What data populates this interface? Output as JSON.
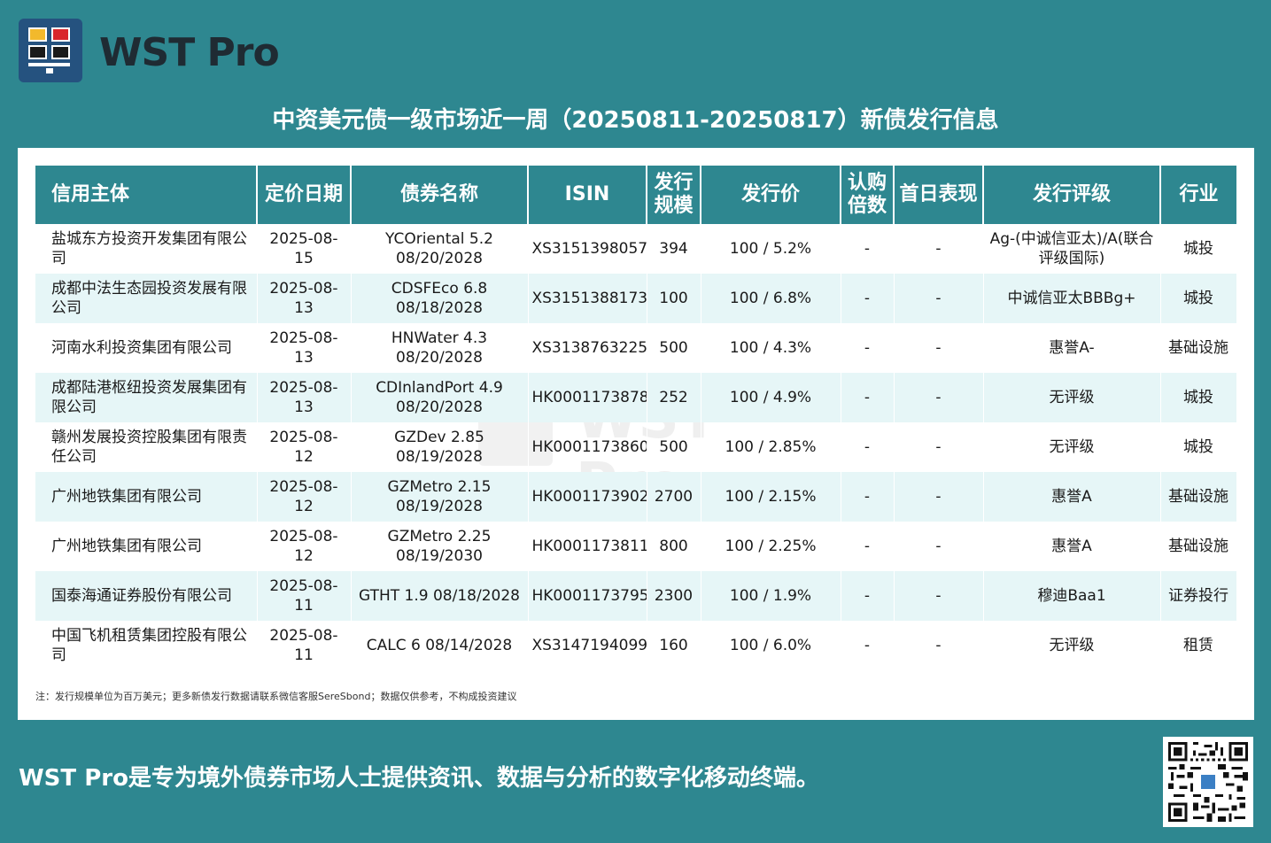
{
  "brand": {
    "name": "WST Pro"
  },
  "title": "中资美元债一级市场近一周（20250811-20250817）新债发行信息",
  "table": {
    "headers": [
      "信用主体",
      "定价日期",
      "债券名称",
      "ISIN",
      "发行规模",
      "发行价",
      "认购倍数",
      "首日表现",
      "发行评级",
      "行业"
    ],
    "rows": [
      [
        "盐城东方投资开发集团有限公司",
        "2025-08-15",
        "YCOriental 5.2 08/20/2028",
        "XS3151398057",
        "394",
        "100 / 5.2%",
        "-",
        "-",
        "Ag-(中诚信亚太)/A(联合评级国际)",
        "城投"
      ],
      [
        "成都中法生态园投资发展有限公司",
        "2025-08-13",
        "CDSFEco 6.8 08/18/2028",
        "XS3151388173",
        "100",
        "100 / 6.8%",
        "-",
        "-",
        "中诚信亚太BBBg+",
        "城投"
      ],
      [
        "河南水利投资集团有限公司",
        "2025-08-13",
        "HNWater 4.3 08/20/2028",
        "XS3138763225",
        "500",
        "100 / 4.3%",
        "-",
        "-",
        "惠誉A-",
        "基础设施"
      ],
      [
        "成都陆港枢纽投资发展集团有限公司",
        "2025-08-13",
        "CDInlandPort 4.9 08/20/2028",
        "HK0001173878",
        "252",
        "100 / 4.9%",
        "-",
        "-",
        "无评级",
        "城投"
      ],
      [
        "赣州发展投资控股集团有限责任公司",
        "2025-08-12",
        "GZDev 2.85 08/19/2028",
        "HK0001173860",
        "500",
        "100 / 2.85%",
        "-",
        "-",
        "无评级",
        "城投"
      ],
      [
        "广州地铁集团有限公司",
        "2025-08-12",
        "GZMetro 2.15 08/19/2028",
        "HK0001173902",
        "2700",
        "100 / 2.15%",
        "-",
        "-",
        "惠誉A",
        "基础设施"
      ],
      [
        "广州地铁集团有限公司",
        "2025-08-12",
        "GZMetro 2.25 08/19/2030",
        "HK0001173811",
        "800",
        "100 / 2.25%",
        "-",
        "-",
        "惠誉A",
        "基础设施"
      ],
      [
        "国泰海通证券股份有限公司",
        "2025-08-11",
        "GTHT 1.9 08/18/2028",
        "HK0001173795",
        "2300",
        "100 / 1.9%",
        "-",
        "-",
        "穆迪Baa1",
        "证券投行"
      ],
      [
        "中国飞机租赁集团控股有限公司",
        "2025-08-11",
        "CALC 6 08/14/2028",
        "XS3147194099",
        "160",
        "100 / 6.0%",
        "-",
        "-",
        "无评级",
        "租赁"
      ]
    ]
  },
  "note": "注：发行规模单位为百万美元；更多新债发行数据请联系微信客服SereSbond；数据仅供参考，不构成投资建议",
  "footer": "WST Pro是专为境外债券市场人士提供资讯、数据与分析的数字化移动终端。",
  "colors": {
    "background": "#2e8790",
    "header_bg": "#2e8790",
    "alt_row": "#e6f6f7",
    "logo_bg": "#25527f"
  }
}
